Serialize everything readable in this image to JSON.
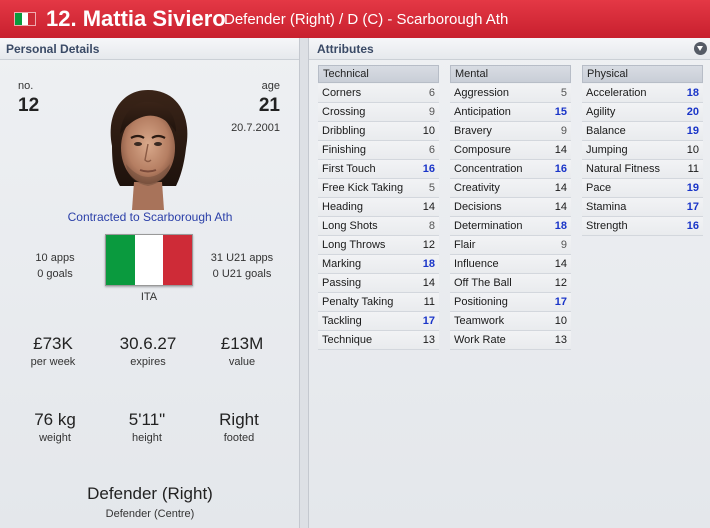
{
  "header": {
    "name": "12. Mattia Siviero",
    "subtitle": "Defender (Right) / D (C) - Scarborough Ath",
    "flag_colors": [
      "#0a9a3e",
      "#ffffff",
      "#ce2b37"
    ]
  },
  "personal": {
    "title": "Personal Details",
    "no_label": "no.",
    "no_value": "12",
    "age_label": "age",
    "age_value": "21",
    "dob": "20.7.2001",
    "contract": "Contracted to Scarborough Ath",
    "apps": "10 apps",
    "goals": "0 goals",
    "u21_apps": "31 U21 apps",
    "u21_goals": "0 U21 goals",
    "nation": "ITA",
    "wage": "£73K",
    "wage_label": "per week",
    "expires": "30.6.27",
    "expires_label": "expires",
    "value": "£13M",
    "value_label": "value",
    "weight": "76 kg",
    "weight_label": "weight",
    "height": "5'11\"",
    "height_label": "height",
    "footed": "Right",
    "footed_label": "footed",
    "position": "Defender (Right)",
    "position_sub": "Defender (Centre)"
  },
  "attributes": {
    "title": "Attributes",
    "colors": {
      "low": "#555555",
      "mid": "#1a1a1a",
      "high": "#1a35c8"
    },
    "technical": {
      "header": "Technical",
      "rows": [
        {
          "name": "Corners",
          "value": "6"
        },
        {
          "name": "Crossing",
          "value": "9"
        },
        {
          "name": "Dribbling",
          "value": "10"
        },
        {
          "name": "Finishing",
          "value": "6"
        },
        {
          "name": "First Touch",
          "value": "16"
        },
        {
          "name": "Free Kick Taking",
          "value": "5"
        },
        {
          "name": "Heading",
          "value": "14"
        },
        {
          "name": "Long Shots",
          "value": "8"
        },
        {
          "name": "Long Throws",
          "value": "12"
        },
        {
          "name": "Marking",
          "value": "18"
        },
        {
          "name": "Passing",
          "value": "14"
        },
        {
          "name": "Penalty Taking",
          "value": "11"
        },
        {
          "name": "Tackling",
          "value": "17"
        },
        {
          "name": "Technique",
          "value": "13"
        }
      ]
    },
    "mental": {
      "header": "Mental",
      "rows": [
        {
          "name": "Aggression",
          "value": "5"
        },
        {
          "name": "Anticipation",
          "value": "15"
        },
        {
          "name": "Bravery",
          "value": "9"
        },
        {
          "name": "Composure",
          "value": "14"
        },
        {
          "name": "Concentration",
          "value": "16"
        },
        {
          "name": "Creativity",
          "value": "14"
        },
        {
          "name": "Decisions",
          "value": "14"
        },
        {
          "name": "Determination",
          "value": "18"
        },
        {
          "name": "Flair",
          "value": "9"
        },
        {
          "name": "Influence",
          "value": "14"
        },
        {
          "name": "Off The Ball",
          "value": "12"
        },
        {
          "name": "Positioning",
          "value": "17"
        },
        {
          "name": "Teamwork",
          "value": "10"
        },
        {
          "name": "Work Rate",
          "value": "13"
        }
      ]
    },
    "physical": {
      "header": "Physical",
      "rows": [
        {
          "name": "Acceleration",
          "value": "18"
        },
        {
          "name": "Agility",
          "value": "20"
        },
        {
          "name": "Balance",
          "value": "19"
        },
        {
          "name": "Jumping",
          "value": "10"
        },
        {
          "name": "Natural Fitness",
          "value": "11"
        },
        {
          "name": "Pace",
          "value": "19"
        },
        {
          "name": "Stamina",
          "value": "17"
        },
        {
          "name": "Strength",
          "value": "16"
        }
      ]
    }
  }
}
